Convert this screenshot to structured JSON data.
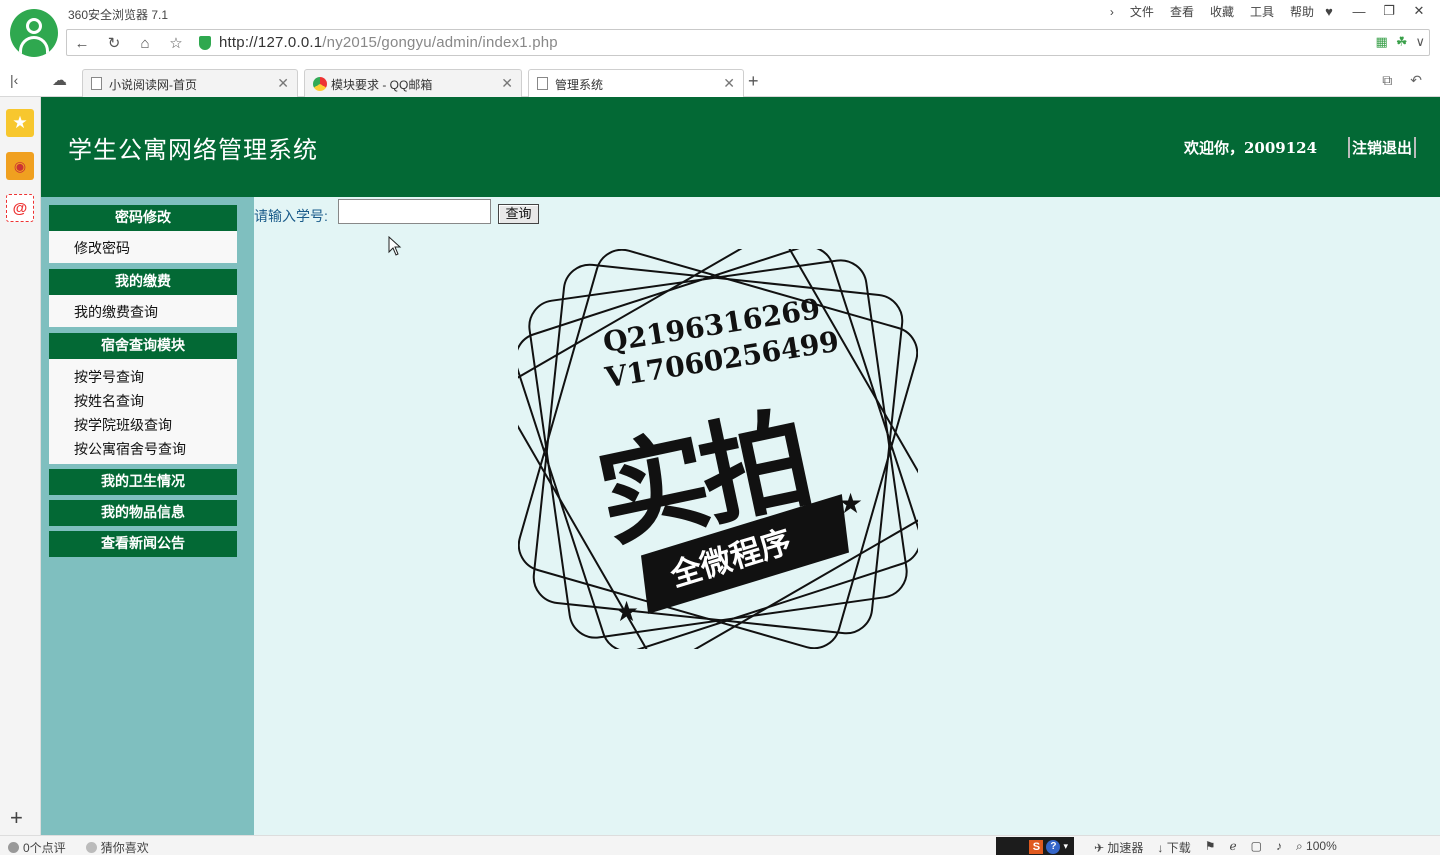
{
  "browser": {
    "app_title": "360安全浏览器 7.1",
    "menu": [
      "文件",
      "查看",
      "收藏",
      "工具",
      "帮助"
    ],
    "url_host": "http://127.0.0.1",
    "url_path": "/ny2015/gongyu/admin/index1.php",
    "tabs": [
      {
        "label": "小说阅读网-首页",
        "active": false
      },
      {
        "label": "模块要求 - QQ邮箱",
        "active": false
      },
      {
        "label": "管理系统",
        "active": true
      }
    ]
  },
  "header": {
    "site_title": "学生公寓网络管理系统",
    "welcome": "欢迎你，2009124",
    "logout": "注销退出"
  },
  "sidebar": {
    "sections": [
      {
        "title": "密码修改",
        "links": [
          "修改密码"
        ]
      },
      {
        "title": "我的缴费",
        "links": [
          "我的缴费查询"
        ]
      },
      {
        "title": "宿舍查询模块",
        "links": [
          "按学号查询",
          "按姓名查询",
          "按学院班级查询",
          "按公寓宿舍号查询"
        ]
      },
      {
        "title": "我的卫生情况",
        "links": []
      },
      {
        "title": "我的物品信息",
        "links": []
      },
      {
        "title": "查看新闻公告",
        "links": []
      }
    ]
  },
  "search": {
    "label": "请输入学号:",
    "value": "",
    "button": "查询"
  },
  "watermark": {
    "line1": "Q2196316269",
    "line2": "V17060256499",
    "big": "实拍",
    "banner": "全微程序"
  },
  "statusbar": {
    "left": [
      "0个点评",
      "猜你喜欢"
    ],
    "right": [
      "加速器",
      "下载",
      "100%"
    ]
  },
  "colors": {
    "header_green": "#036935",
    "sidebar_teal": "#7fbfbf",
    "main_bg": "#e3f5f5"
  }
}
